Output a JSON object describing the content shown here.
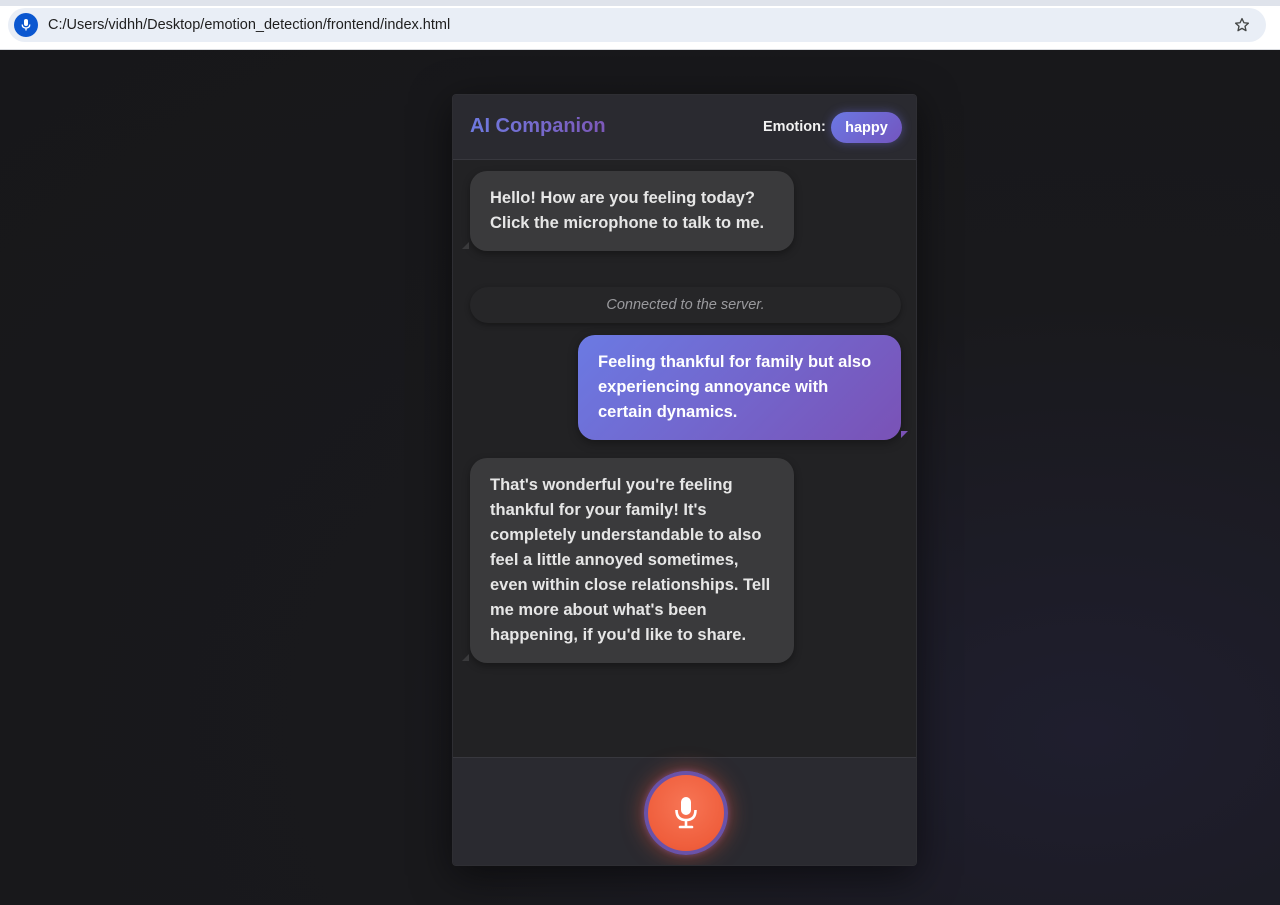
{
  "browser": {
    "url": "C:/Users/vidhh/Desktop/emotion_detection/frontend/index.html",
    "site_icon": "microphone-icon",
    "bookmark_icon": "star-icon"
  },
  "app": {
    "title": "AI Companion",
    "emotion_label": "Emotion:",
    "emotion_value": "happy",
    "accent_colors": [
      "#6b7ae3",
      "#7a52b6"
    ],
    "mic_button_color": "#ef5e3c"
  },
  "chat": {
    "messages": [
      {
        "role": "ai",
        "text": "Hello! How are you feeling today? Click the microphone to talk to me."
      },
      {
        "role": "status",
        "text": "Connected to the server."
      },
      {
        "role": "user",
        "text": "Feeling thankful for family but also experiencing annoyance with certain dynamics."
      },
      {
        "role": "ai",
        "text": "That's wonderful you're feeling thankful for your family! It's completely understandable to also feel a little annoyed sometimes, even within close relationships. Tell me more about what's been happening, if you'd like to share."
      }
    ]
  },
  "footer": {
    "mic_icon": "microphone-icon"
  }
}
